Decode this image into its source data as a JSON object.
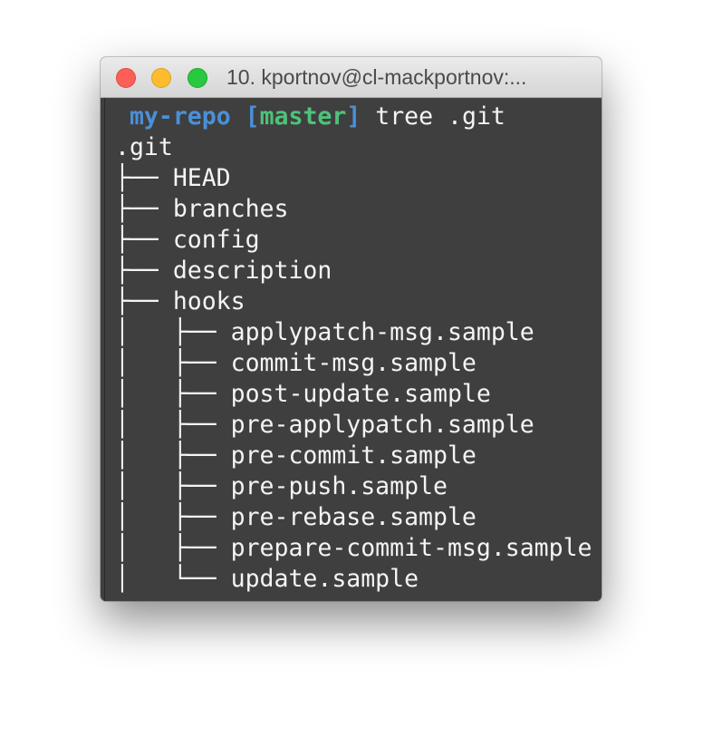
{
  "window": {
    "title": "10. kportnov@cl-mackportnov:..."
  },
  "prompt": {
    "dir": "my-repo",
    "branch_open": "[",
    "branch": "master",
    "branch_close": "]",
    "command": "tree .git"
  },
  "output": [
    ".git",
    "├── HEAD",
    "├── branches",
    "├── config",
    "├── description",
    "├── hooks",
    "│   ├── applypatch-msg.sample",
    "│   ├── commit-msg.sample",
    "│   ├── post-update.sample",
    "│   ├── pre-applypatch.sample",
    "│   ├── pre-commit.sample",
    "│   ├── pre-push.sample",
    "│   ├── pre-rebase.sample",
    "│   ├── prepare-commit-msg.sample",
    "│   └── update.sample"
  ]
}
